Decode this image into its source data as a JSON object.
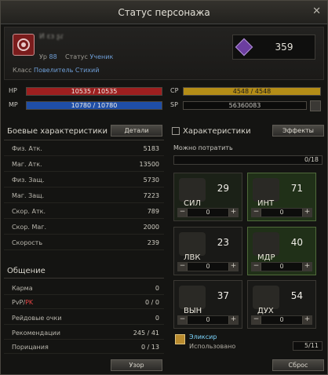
{
  "window": {
    "title": "Статус персонажа",
    "close": "✕"
  },
  "character": {
    "name_blur": "Ͷ ɛɜ ʂɾ",
    "level_label": "Ур",
    "level": "88",
    "status_label": "Статус",
    "status": "Ученик",
    "class_label": "Класс",
    "class_value": "Повелитель Стихий",
    "score": "359"
  },
  "resources": {
    "hp_label": "HP",
    "hp_value": "10535 / 10535",
    "mp_label": "MP",
    "mp_value": "10780 / 10780",
    "cp_label": "CP",
    "cp_value": "4548 / 4548",
    "sp_label": "SP",
    "sp_value": "56360083"
  },
  "combat": {
    "title": "Боевые характеристики",
    "details_button": "Детали",
    "stats": [
      {
        "name": "Физ. Атк.",
        "value": "5183"
      },
      {
        "name": "Маг. Атк.",
        "value": "13500"
      },
      {
        "name": "Физ. Защ.",
        "value": "5730"
      },
      {
        "name": "Маг. Защ.",
        "value": "7223"
      },
      {
        "name": "Скор. Атк.",
        "value": "789"
      },
      {
        "name": "Скор. Маг.",
        "value": "2000"
      },
      {
        "name": "Скорость",
        "value": "239"
      }
    ]
  },
  "general": {
    "title": "Общение",
    "rows": [
      {
        "name": "Карма",
        "value": "0"
      },
      {
        "name_a": "PvP",
        "name_sep": "/",
        "name_b": "PK",
        "value": "0 / 0"
      },
      {
        "name": "Рейдовые очки",
        "value": "0"
      },
      {
        "name": "Рекомендации",
        "value": "245 / 41"
      },
      {
        "name": "Порицания",
        "value": "0 / 13"
      }
    ],
    "view_button": "Узор"
  },
  "attributes": {
    "title": "Характеристики",
    "effects_button": "Эффекты",
    "spend_label": "Можно потратить",
    "spend_value": "0/18",
    "tiles": [
      {
        "name": "СИЛ",
        "value": "29",
        "add": "0"
      },
      {
        "name": "ИНТ",
        "value": "71",
        "add": "0"
      },
      {
        "name": "ЛВК",
        "value": "23",
        "add": "0"
      },
      {
        "name": "МДР",
        "value": "40",
        "add": "0"
      },
      {
        "name": "ВЫН",
        "value": "37",
        "add": "0"
      },
      {
        "name": "ДУХ",
        "value": "54",
        "add": "0"
      }
    ],
    "elixir_name": "Эликсир",
    "elixir_used_label": "Использовано",
    "elixir_count": "5/11",
    "reset_button": "Сброс"
  },
  "icons": {
    "plus": "+",
    "minus": "−"
  }
}
